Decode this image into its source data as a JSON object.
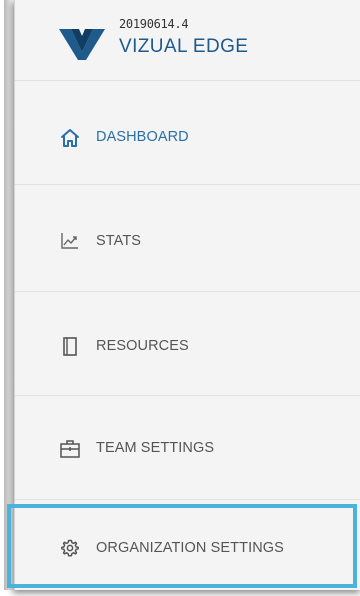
{
  "app": {
    "version": "20190614.4",
    "brand": "VIZUAL EDGE"
  },
  "nav": {
    "items": [
      {
        "label": "DASHBOARD",
        "icon": "home-icon",
        "active": true
      },
      {
        "label": "STATS",
        "icon": "trending-chart-icon",
        "active": false
      },
      {
        "label": "RESOURCES",
        "icon": "book-icon",
        "active": false
      },
      {
        "label": "TEAM SETTINGS",
        "icon": "briefcase-icon",
        "active": false
      },
      {
        "label": "ORGANIZATION SETTINGS",
        "icon": "gear-icon",
        "active": false
      }
    ]
  },
  "colors": {
    "brand_blue": "#1f5a8c",
    "active_blue": "#2a6fa8",
    "highlight": "#4ab3dc",
    "panel_bg": "#f4f4f4"
  }
}
